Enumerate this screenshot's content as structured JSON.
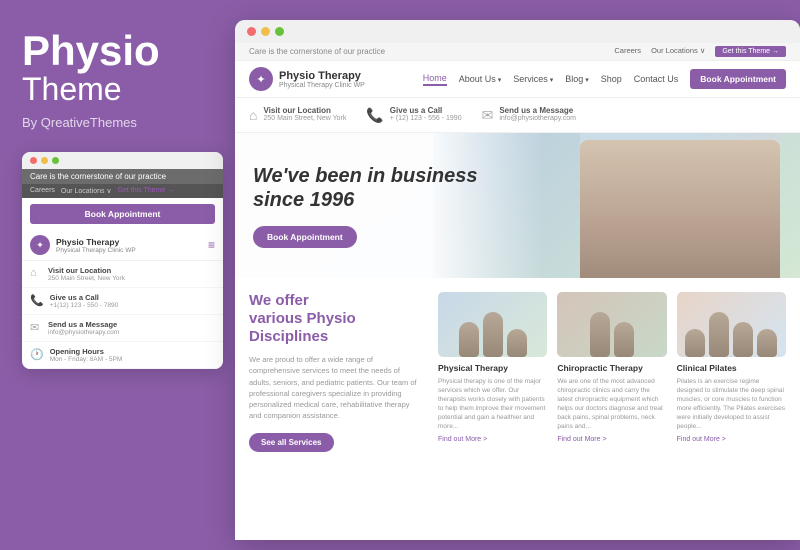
{
  "left": {
    "title_physio": "Physio",
    "title_theme": "Theme",
    "by": "By QreativeThemes"
  },
  "mini_browser": {
    "top_bar_text": "Care is the cornerstone of our practice",
    "nav_careers": "Careers",
    "nav_locations": "Our Locations ∨",
    "nav_get_theme": "Get this Theme →",
    "book_btn": "Book Appointment",
    "logo_name": "Physio Therapy",
    "logo_sub": "Physical Therapy Clinic WP",
    "menu_icon": "≡",
    "info_items": [
      {
        "icon": "⌂",
        "label": "Visit our Location",
        "val": "250 Main Street, New York"
      },
      {
        "icon": "📞",
        "label": "Give us a Call",
        "val": "+1(12) 123 - 550 - 7890"
      },
      {
        "icon": "✉",
        "label": "Send us a Message",
        "val": "info@physiotherapy.com"
      },
      {
        "icon": "🕐",
        "label": "Opening Hours",
        "val": "Mon - Friday: 8AM - 5PM"
      }
    ]
  },
  "site": {
    "top_bar_text": "Care is the cornerstone of our practice",
    "top_bar_links": [
      "Careers",
      "Our Locations ∨",
      "Get this Theme →"
    ],
    "logo_name": "Physio Therapy",
    "logo_sub": "Physical Therapy Clinic WP",
    "nav_links": [
      "Home",
      "About Us ∨",
      "Services ∨",
      "Blog ∨",
      "Shop",
      "Contact Us"
    ],
    "nav_book_btn": "Book Appointment",
    "info_items": [
      {
        "icon": "⌂",
        "label": "Visit our Location",
        "val": "250 Main Street, New York"
      },
      {
        "icon": "📞",
        "label": "Give us a Call",
        "val": "+1(12) 123 - 556 - 1990"
      },
      {
        "icon": "✉",
        "label": "Send us a Message",
        "val": "info@physiotherapy.com"
      }
    ],
    "hero_title_line1": "We've been in business",
    "hero_title_line2": "since 1996",
    "hero_cta": "Book Appointment",
    "content_title_we": "We offer",
    "content_title_various": "various Physio",
    "content_title_disciplines": "Disciplines",
    "content_text": "We are proud to offer a wide range of comprehensive services to meet the needs of adults, seniors, and pediatric patients. Our team of professional caregivers specialize in providing personalized medical care, rehabilitative therapy and companion assistance.",
    "content_see_btn": "See all Services",
    "cards": [
      {
        "title": "Physical Therapy",
        "text": "Physical therapy is one of the major services which we offer. Our therapists works closely with patients to help them improve their movement potential and gain a healthier and more...",
        "link": "Find out More >"
      },
      {
        "title": "Chiropractic Therapy",
        "text": "We are one of the most advanced chiropractic clinics and carry the latest chiropractic equipment which helps our doctors diagnose and treat back pains, spinal problems, neck pains and...",
        "link": "Find out More >"
      },
      {
        "title": "Clinical Pilates",
        "text": "Pilates is an exercise regime designed to stimulate the deep spinal muscles, or core muscles to function more efficiently. The Pilates exercises were initially developed to assist people...",
        "link": "Find out More >"
      }
    ]
  },
  "colors": {
    "accent": "#8B5DA8",
    "text_dark": "#333333",
    "text_muted": "#999999"
  }
}
